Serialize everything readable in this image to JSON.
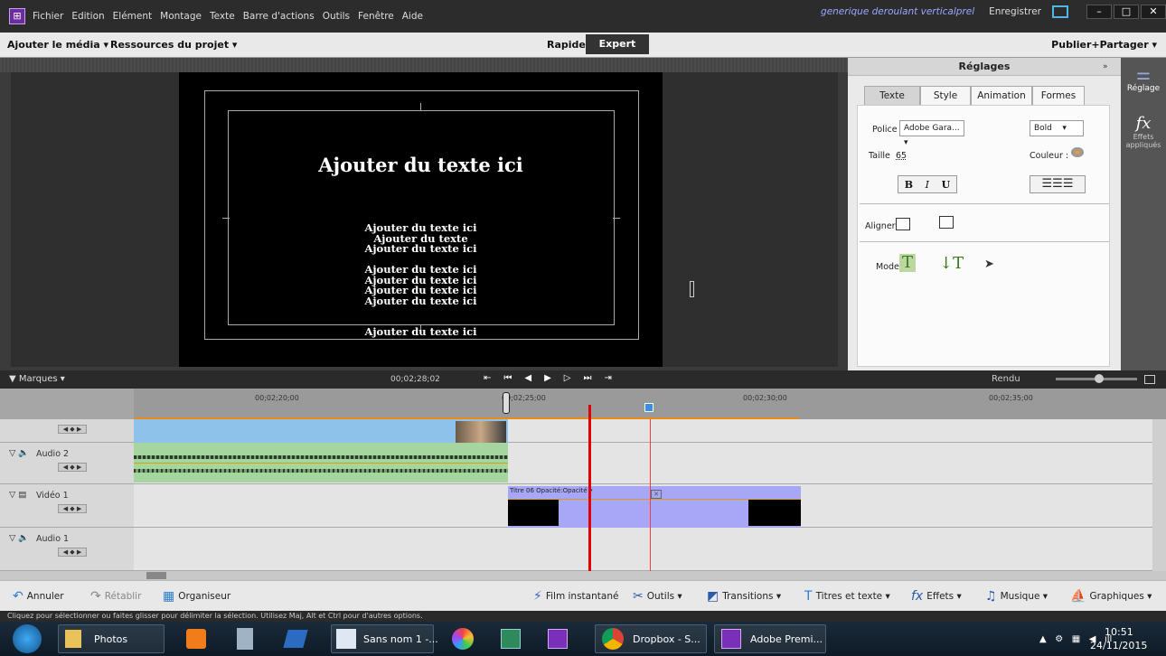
{
  "menubar": {
    "items": [
      "Fichier",
      "Edition",
      "Elément",
      "Montage",
      "Texte",
      "Barre d'actions",
      "Outils",
      "Fenêtre",
      "Aide"
    ],
    "project_title": "generique deroulant verticalprel",
    "save_label": "Enregistrer"
  },
  "toolbar": {
    "add_media": "Ajouter le média ▾",
    "project_resources": "Ressources du projet ▾",
    "quick": "Rapide",
    "expert": "Expert",
    "publish": "Publier+Partager ▾"
  },
  "canvas": {
    "title": "Ajouter du texte ici",
    "lines": [
      "Ajouter du texte ici",
      "Ajouter du texte",
      "Ajouter du texte ici",
      "",
      "Ajouter du texte ici",
      "Ajouter du texte ici",
      "Ajouter du texte ici",
      "Ajouter du texte ici",
      "",
      "",
      "Ajouter du texte ici"
    ]
  },
  "settings": {
    "header": "Réglages",
    "tabs": [
      "Texte",
      "Style",
      "Animation",
      "Formes"
    ],
    "font_label": "Police",
    "font_value": "Adobe Gara...",
    "weight_value": "Bold",
    "size_label": "Taille",
    "size_value": "65",
    "color_label": "Couleur :",
    "bold": "B",
    "italic": "I",
    "underline": "U",
    "align_label": "Aligner",
    "mode_label": "Mode"
  },
  "rightstrip": {
    "adjust": "Réglage",
    "effects": "Effets appliqués"
  },
  "timeline": {
    "markers": "Marques",
    "current_time": "00;02;28;02",
    "render": "Rendu",
    "ruler": [
      "00;02;20;00",
      "00;02;25;00",
      "00;02;30;00",
      "00;02;35;00"
    ],
    "tracks": [
      {
        "name": ""
      },
      {
        "name": "Audio 2"
      },
      {
        "name": "Vidéo 1"
      },
      {
        "name": "Audio 1"
      }
    ],
    "clip_label": "Titre 06  Opacité:Opacité ▾"
  },
  "actions": {
    "undo": "Annuler",
    "redo": "Rétablir",
    "organizer": "Organiseur",
    "instant_movie": "Film instantané",
    "tools": "Outils ▾",
    "transitions": "Transitions ▾",
    "titles": "Titres et texte ▾",
    "effects": "Effets ▾",
    "music": "Musique ▾",
    "graphics": "Graphiques ▾"
  },
  "status": "Cliquez pour sélectionner ou faites glisser pour délimiter la sélection. Utilisez Maj, Alt et Ctrl pour d'autres options.",
  "taskbar": {
    "photos": "Photos",
    "sans_nom": "Sans nom 1 -...",
    "dropbox": "Dropbox - S...",
    "adobe": "Adobe Premi...",
    "time": "10:51",
    "date": "24/11/2015"
  }
}
